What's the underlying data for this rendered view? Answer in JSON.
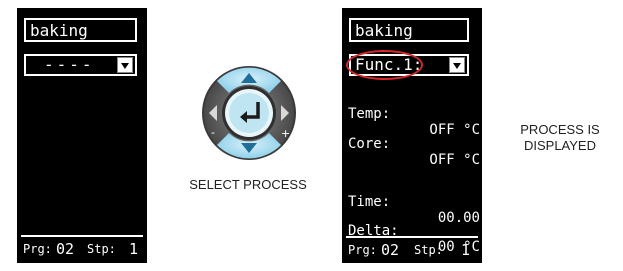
{
  "left_display": {
    "title": "baking",
    "program_value": "----",
    "footer_prg_label": "Prg:",
    "footer_prg_value": "02",
    "footer_stp_label": "Stp:",
    "footer_stp_value": "1"
  },
  "right_display": {
    "title": "baking",
    "function_value": "Func.1:",
    "rows": [
      {
        "label": "Temp:",
        "value": "OFF °C"
      },
      {
        "label": "Core:",
        "value": "OFF °C"
      },
      {
        "label": "Time:",
        "value": "00.00"
      },
      {
        "label": "Delta:",
        "value": "00 °C"
      }
    ],
    "footer_prg_label": "Prg:",
    "footer_prg_value": "02",
    "footer_stp_label": "Stp:",
    "footer_stp_value": "1"
  },
  "keypad": {
    "minus_symbol": "-",
    "plus_symbol": "+",
    "colors": {
      "ring": "#a9dcef",
      "center": "#b0dcec",
      "arrows": "#1f6f9a",
      "sides": "#555555"
    }
  },
  "captions": {
    "select": "SELECT PROCESS",
    "process_line1": "PROCESS IS",
    "process_line2": "DISPLAYED"
  },
  "colors": {
    "lcd_bg": "#000000",
    "lcd_fg": "#ffffff",
    "highlight": "#d7262c"
  }
}
